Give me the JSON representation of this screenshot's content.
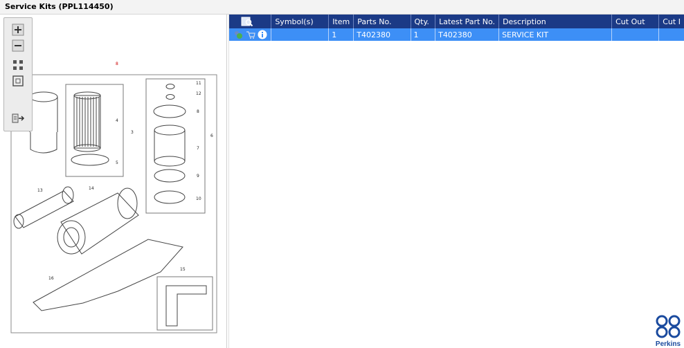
{
  "window": {
    "title": "Service Kits (PPL114450)"
  },
  "toolbar": {
    "buttons": [
      {
        "name": "zoom-in-button",
        "icon": "plus-icon"
      },
      {
        "name": "zoom-out-button",
        "icon": "minus-icon"
      },
      {
        "name": "fit-page-button",
        "icon": "grid-icon"
      },
      {
        "name": "actual-size-button",
        "icon": "square-icon"
      },
      {
        "name": "export-button",
        "icon": "export-icon"
      }
    ]
  },
  "diagram": {
    "marker": "8",
    "callouts": [
      "11",
      "12",
      "8",
      "6",
      "4",
      "3",
      "7",
      "5",
      "9",
      "10",
      "13",
      "14",
      "16",
      "15"
    ]
  },
  "table": {
    "headers": [
      "",
      "Symbol(s)",
      "Item",
      "Parts No.",
      "Qty.",
      "Latest Part No.",
      "Description",
      "Cut Out",
      "Cut I"
    ],
    "rows": [
      {
        "symbols": "",
        "item": "1",
        "parts_no": "T402380",
        "qty": "1",
        "latest_part_no": "T402380",
        "description": "SERVICE KIT",
        "cut_out": "",
        "cut_in": ""
      }
    ]
  },
  "branding": {
    "logo_text": "Perkins",
    "logo_color": "#1a4a9e"
  },
  "colors": {
    "header_bg": "#1b3a86",
    "selected_row": "#3d8ff6"
  }
}
